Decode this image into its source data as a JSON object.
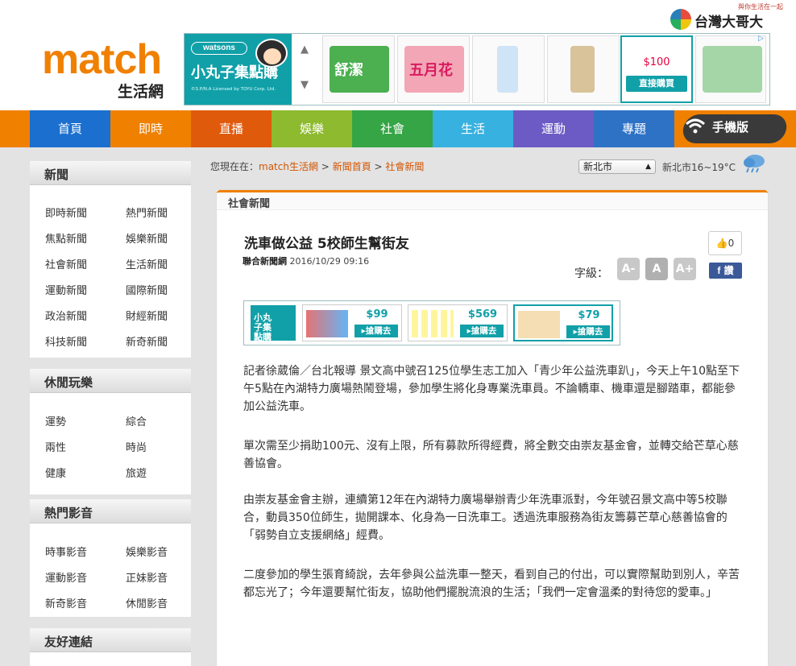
{
  "site": {
    "logo": "match",
    "logo_sub": "生活網"
  },
  "partner": {
    "slogan": "與你生活在一起",
    "name": "台灣大哥大"
  },
  "banner": {
    "watsons": "watsons",
    "title": "小丸子集點購",
    "license": "©S.P/N.A Licensed by TOYU Corp. Ltd.",
    "products": [
      "舒潔",
      "五月花",
      "",
      ""
    ],
    "featured_price": "$100",
    "featured_button": "直接購買"
  },
  "nav": {
    "items": [
      "首頁",
      "即時",
      "直播",
      "娛樂",
      "社會",
      "生活",
      "運動",
      "專題"
    ],
    "colors": [
      "#1a6fcf",
      "#f08000",
      "#e05a0c",
      "#8dba2e",
      "#35a545",
      "#37b1e0",
      "#6c5bc4",
      "#2e72c6"
    ],
    "mobile": "手機版"
  },
  "sidebar": {
    "blocks": [
      {
        "title": "新聞",
        "links": [
          "即時新聞",
          "熱門新聞",
          "焦點新聞",
          "娛樂新聞",
          "社會新聞",
          "生活新聞",
          "運動新聞",
          "國際新聞",
          "政治新聞",
          "財經新聞",
          "科技新聞",
          "新奇新聞"
        ]
      },
      {
        "title": "休閒玩樂",
        "links": [
          "運勢",
          "綜合",
          "兩性",
          "時尚",
          "健康",
          "旅遊"
        ]
      },
      {
        "title": "熱門影音",
        "links": [
          "時事影音",
          "娛樂影音",
          "運動影音",
          "正妹影音",
          "新奇影音",
          "休閒影音"
        ]
      },
      {
        "title": "友好連結",
        "links": []
      }
    ]
  },
  "breadcrumb": {
    "prefix": "您現在在：",
    "items": [
      "match生活網",
      "新聞首頁",
      "社會新聞"
    ],
    "sep": ">"
  },
  "weather": {
    "city": "新北市",
    "text": "新北市16~19°C"
  },
  "article": {
    "section": "社會新聞",
    "title": "洗車做公益 5校師生幫街友",
    "source": "聯合新聞網",
    "datetime": "2016/10/29 09:16",
    "likes": "0",
    "share": "讚",
    "fontsize_label": "字級：",
    "fontsize_buttons": [
      "A-",
      "A",
      "A+"
    ],
    "paragraphs": [
      "記者徐葳倫／台北報導 景文高中號召125位學生志工加入「青少年公益洗車趴」，今天上午10點至下午5點在內湖特力廣場熱鬧登場，參加學生將化身專業洗車員。不論轎車、機車還是腳踏車，都能參加公益洗車。",
      "單次需至少捐助100元、沒有上限，所有募款所得經費，將全數交由崇友基金會，並轉交給芒草心慈善協會。",
      "由崇友基金會主辦，連續第12年在內湖特力廣場舉辦青少年洗車派對，今年號召景文高中等5校聯合，動員350位師生，拋開課本、化身為一日洗車工。透過洗車服務為街友籌募芒草心慈善協會的「弱勢自立支援網絡」經費。",
      "二度參加的學生張育綺說，去年參與公益洗車一整天，看到自己的付出，可以實際幫助到別人，辛苦都忘光了；今年還要幫忙街友，協助他們擺脫流浪的生活；「我們一定會溫柔的對待您的愛車。」"
    ]
  },
  "ad2": {
    "title": "小丸子集點購",
    "cards": [
      {
        "price": "$99",
        "button": "▸搶購去"
      },
      {
        "price": "$569",
        "button": "▸搶購去"
      },
      {
        "price": "$79",
        "button": "▸搶購去"
      }
    ]
  }
}
